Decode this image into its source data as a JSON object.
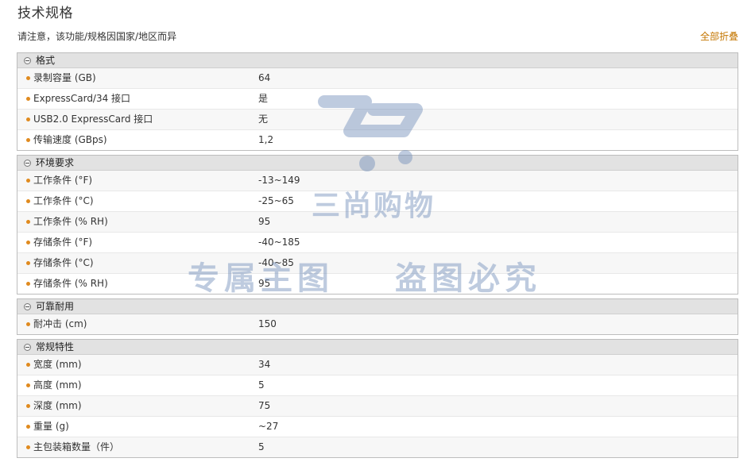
{
  "page": {
    "title": "技术规格",
    "notice": "请注意，该功能/规格因国家/地区而异",
    "collapse_all": "全部折叠"
  },
  "groups": [
    {
      "name": "格式",
      "rows": [
        {
          "label": "录制容量 (GB)",
          "value": "64"
        },
        {
          "label": "ExpressCard/34 接口",
          "value": "是"
        },
        {
          "label": "USB2.0 ExpressCard 接口",
          "value": "无"
        },
        {
          "label": "传输速度 (GBps)",
          "value": "1,2"
        }
      ]
    },
    {
      "name": "环境要求",
      "rows": [
        {
          "label": "工作条件 (°F)",
          "value": "-13~149"
        },
        {
          "label": "工作条件 (°C)",
          "value": "-25~65"
        },
        {
          "label": "工作条件 (% RH)",
          "value": "95"
        },
        {
          "label": "存储条件 (°F)",
          "value": "-40~185"
        },
        {
          "label": "存储条件 (°C)",
          "value": "-40~85"
        },
        {
          "label": "存储条件 (% RH)",
          "value": "95"
        }
      ]
    },
    {
      "name": "可靠耐用",
      "rows": [
        {
          "label": "耐冲击 (cm)",
          "value": "150"
        }
      ]
    },
    {
      "name": "常规特性",
      "rows": [
        {
          "label": "宽度 (mm)",
          "value": "34"
        },
        {
          "label": "高度 (mm)",
          "value": "5"
        },
        {
          "label": "深度 (mm)",
          "value": "75"
        },
        {
          "label": "重量 (g)",
          "value": "~27"
        },
        {
          "label": "主包装箱数量（件）",
          "value": "5"
        }
      ]
    }
  ],
  "watermark": {
    "brand": "三尚购物",
    "line1": "专属主图",
    "line2": "盗图必究",
    "icon": "shopping-cart-icon",
    "color": "#6e8cb9"
  },
  "colors": {
    "accent": "#c47600",
    "bullet": "#e08a1e",
    "header_bg": "#e2e2e2",
    "border": "#bdbdbd"
  }
}
